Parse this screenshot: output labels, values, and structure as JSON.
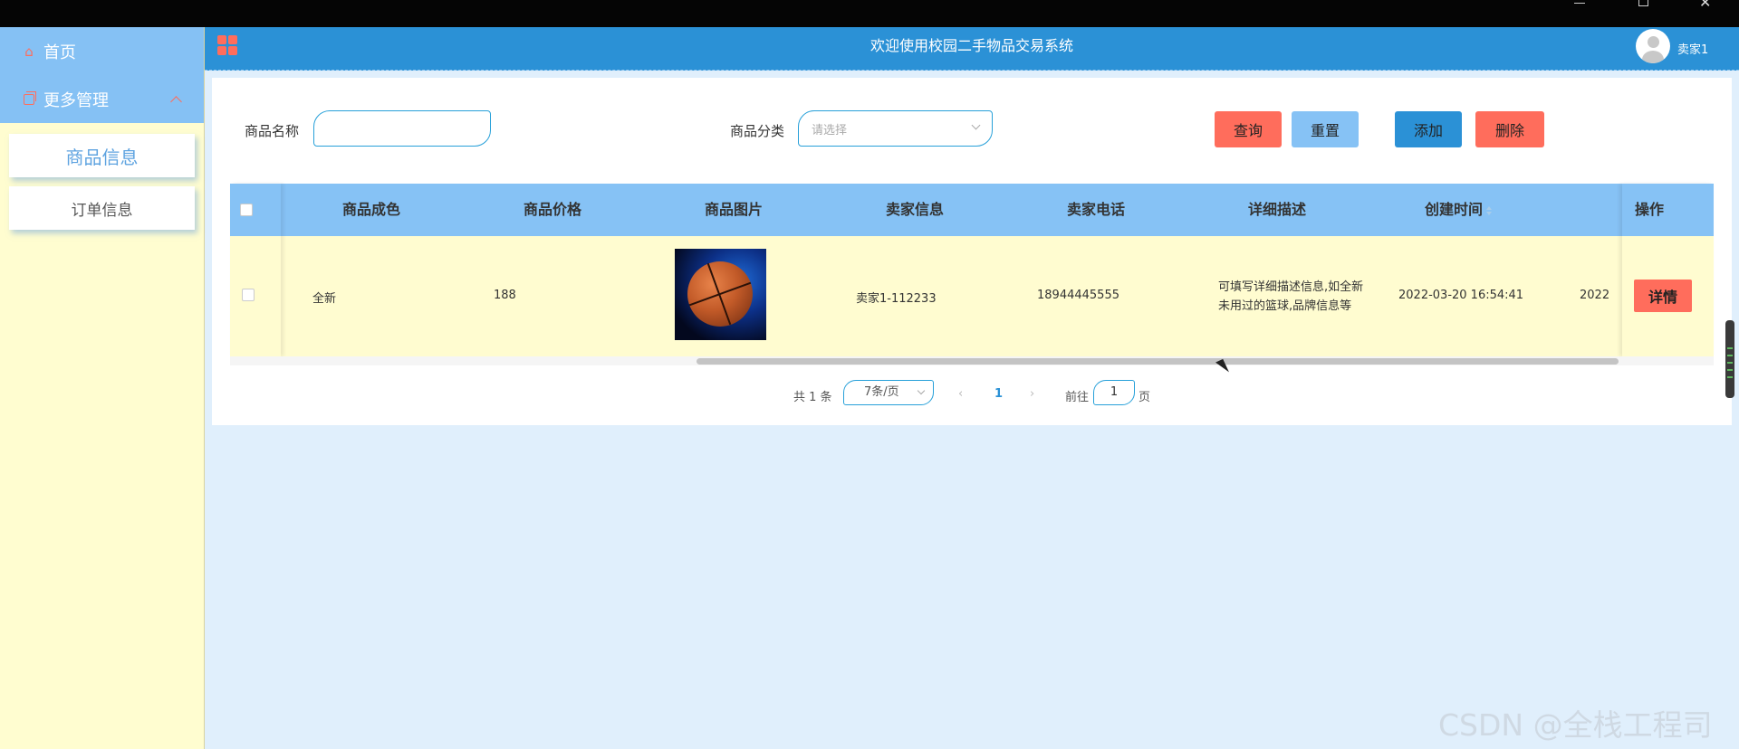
{
  "sidebar": {
    "home_label": "首页",
    "mgmt_label": "更多管理",
    "sub_items": [
      "商品信息",
      "订单信息"
    ]
  },
  "header": {
    "title": "欢迎使用校园二手物品交易系统",
    "user_name": "卖家1"
  },
  "search": {
    "name_label": "商品名称",
    "name_value": "",
    "category_label": "商品分类",
    "category_placeholder": "请选择",
    "query_button": "查询",
    "reset_button": "重置",
    "add_button": "添加",
    "delete_button": "删除"
  },
  "table": {
    "headers": [
      "商品成色",
      "商品价格",
      "商品图片",
      "卖家信息",
      "卖家电话",
      "详细描述",
      "创建时间",
      "操作"
    ],
    "rows": [
      {
        "condition": "全新",
        "price": "188",
        "seller": "卖家1-112233",
        "phone": "18944445555",
        "desc_line1": "可填写详细描述信息,如全新",
        "desc_line2": "未用过的篮球,品牌信息等",
        "created": "2022-03-20 16:54:41",
        "clipped": "2022",
        "action": "详情"
      }
    ]
  },
  "pager": {
    "total": "共 1 条",
    "page_size": "7条/页",
    "current_page": "1",
    "goto_label": "前往",
    "goto_value": "1",
    "page_suffix": "页"
  },
  "watermark": "CSDN @全栈工程司",
  "colors": {
    "header_blue": "#2b91d6",
    "light_blue": "#86c2f5",
    "accent_red": "#ff6d5c",
    "row_yellow": "#fffcd0"
  }
}
